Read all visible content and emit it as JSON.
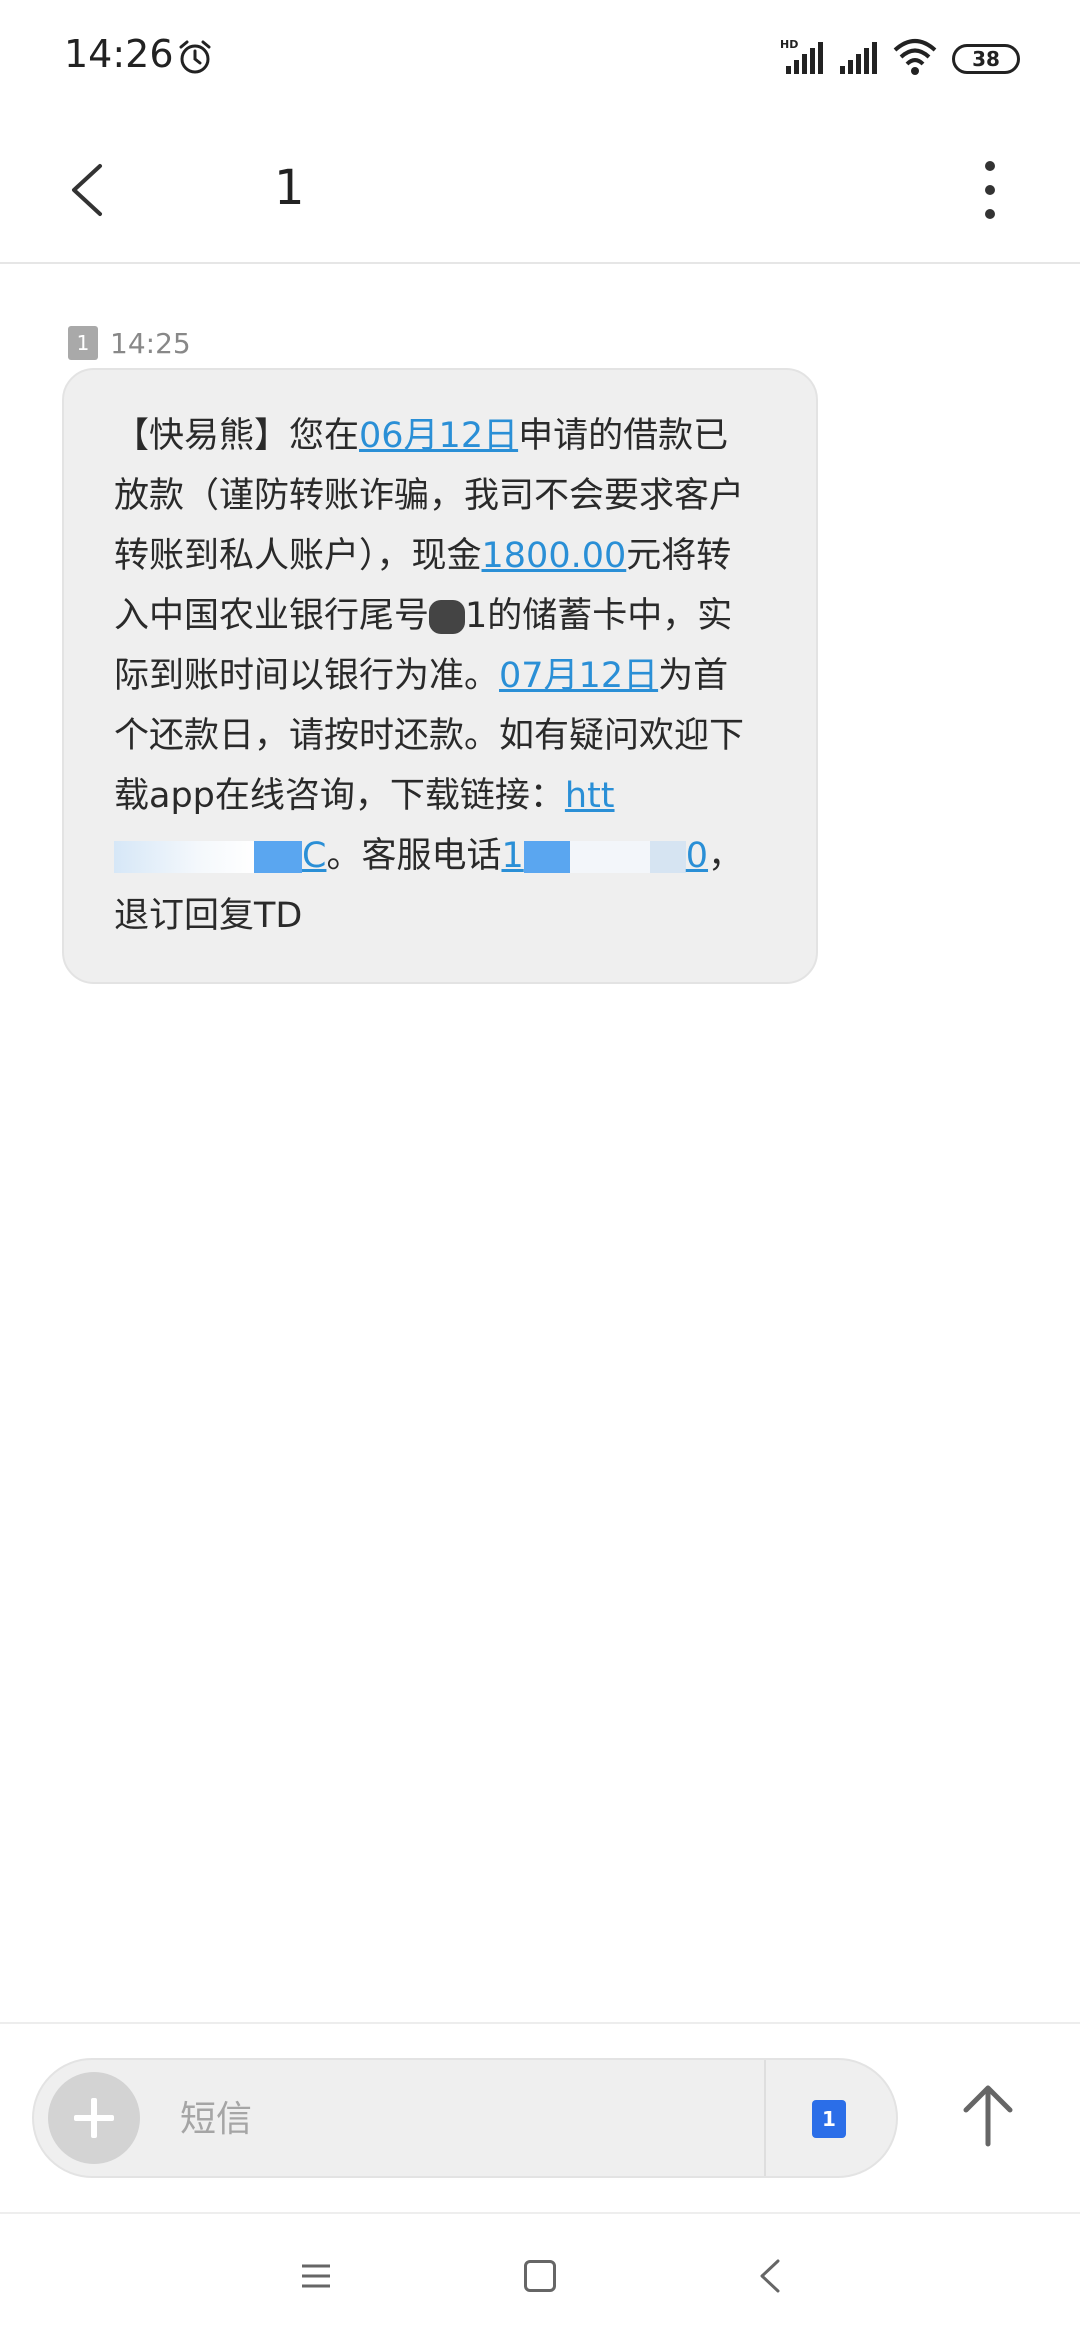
{
  "status_bar": {
    "time": "14:26",
    "network_label": "HD",
    "battery": "38"
  },
  "header": {
    "contact": "1",
    "icons": {
      "back": "back-arrow-icon",
      "more": "more-vertical-icon"
    }
  },
  "message": {
    "sim_badge": "1",
    "time": "14:25",
    "parts": {
      "p1": "【快易熊】您在",
      "date1": "06月12日",
      "p2": "申请的借款已放款（谨防转账诈骗，我司不会要求客户转账到私人账户），现金",
      "amount": "1800.00",
      "p3": "元将转入中国农业银行尾号",
      "p4": "1的储蓄卡中，实际到账时间以银行为准。",
      "date2": "07月12日",
      "p5": "为首个还款日，请按时还款。如有疑问欢迎下载app在线咨询，下载链接：",
      "link_text": "htt",
      "link_tail": "C",
      "p6": "。客服电话",
      "phone_text": "1",
      "phone_tail": "0",
      "p7": "，退订回复TD"
    },
    "link_color": "#2a8fd6"
  },
  "compose": {
    "placeholder": "短信",
    "sim_label": "1",
    "sim_color": "#2b6ee8",
    "icons": {
      "add": "add-icon",
      "send": "send-arrow-icon"
    }
  },
  "nav": {
    "icons": [
      "menu-icon",
      "home-icon",
      "back-icon"
    ]
  }
}
